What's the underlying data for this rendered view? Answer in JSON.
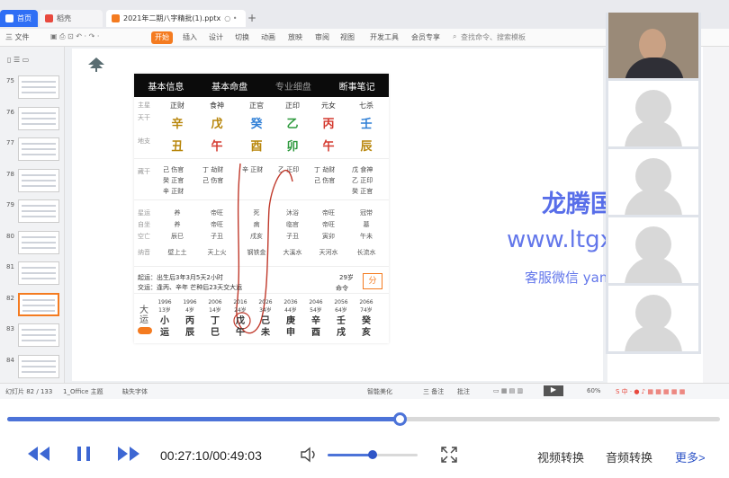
{
  "tabs": [
    {
      "label": "首页",
      "icon": "home-icon",
      "color": "#2f6ff5"
    },
    {
      "label": "稻壳",
      "icon": "docer-icon",
      "color": "#e8493e"
    },
    {
      "label": "2021年二期八字精批(1).pptx",
      "icon": "ppt-icon",
      "color": "#f47b20"
    }
  ],
  "menu": {
    "file": "三 文件",
    "items": [
      "开始",
      "插入",
      "设计",
      "切换",
      "动画",
      "放映",
      "审阅",
      "视图",
      "开发工具",
      "会员专享"
    ],
    "search": "查找命令、搜索模板"
  },
  "slides": {
    "numbers": [
      "75",
      "76",
      "77",
      "78",
      "79",
      "80",
      "81",
      "82",
      "83",
      "84"
    ],
    "selected": "82"
  },
  "panel": {
    "tabs": [
      "基本信息",
      "基本命盘",
      "专业细盘",
      "断事笔记"
    ],
    "active_tab": "专业细盘",
    "row_labels": [
      "主星",
      "天干",
      "地支",
      "藏干",
      "星运",
      "自坐",
      "空亡",
      "纳音"
    ],
    "ten_gods": [
      "正财",
      "食神",
      "正官",
      "正印",
      "元女",
      "七杀"
    ],
    "stems": [
      {
        "char": "辛",
        "color": "#b8860b"
      },
      {
        "char": "戊",
        "color": "#b8860b"
      },
      {
        "char": "癸",
        "color": "#2f7fd6"
      },
      {
        "char": "乙",
        "color": "#2e9a3e"
      },
      {
        "char": "丙",
        "color": "#d43a2f"
      },
      {
        "char": "壬",
        "color": "#2f7fd6"
      }
    ],
    "branches": [
      {
        "char": "丑",
        "color": "#b8860b"
      },
      {
        "char": "午",
        "color": "#d43a2f"
      },
      {
        "char": "酉",
        "color": "#b8860b"
      },
      {
        "char": "卯",
        "color": "#2e9a3e"
      },
      {
        "char": "午",
        "color": "#d43a2f"
      },
      {
        "char": "辰",
        "color": "#b8860b"
      }
    ],
    "hidden_stems": [
      [
        "己 伤官",
        "癸 正官",
        "辛 正财"
      ],
      [
        "丁 劫财",
        "己 伤官"
      ],
      [
        "辛 正财"
      ],
      [
        "乙 正印"
      ],
      [
        "丁 劫财",
        "己 伤官"
      ],
      [
        "戊 食神",
        "乙 正印",
        "癸 正官"
      ]
    ],
    "star_luck": [
      "养",
      "帝旺",
      "死",
      "沐浴",
      "帝旺",
      "冠带"
    ],
    "self_seat": [
      "养",
      "帝旺",
      "病",
      "临官",
      "帝旺",
      "墓"
    ],
    "kong_wang": [
      "辰巳",
      "子丑",
      "戌亥",
      "子丑",
      "寅卯",
      "午未"
    ],
    "na_yin": [
      "壁上土",
      "天上火",
      "钢铁金",
      "大溪水",
      "天河水",
      "长流水"
    ],
    "info1": "起运：出生后3年3月5天2小时",
    "info2": "交运：逢丙、辛年 芒种后23天交大运",
    "age": "29岁",
    "dayun_label_now": "命令",
    "share_label": "分",
    "dayun_label": "大运",
    "dayun": [
      {
        "year": "1996",
        "age": "13岁",
        "stem": "小",
        "branch": "运"
      },
      {
        "year": "1996",
        "age": "4岁",
        "stem": "丙",
        "branch": "辰"
      },
      {
        "year": "2006",
        "age": "14岁",
        "stem": "丁",
        "branch": "巳"
      },
      {
        "year": "2016",
        "age": "24岁",
        "stem": "戊",
        "branch": "午"
      },
      {
        "year": "2026",
        "age": "34岁",
        "stem": "己",
        "branch": "未"
      },
      {
        "year": "2036",
        "age": "44岁",
        "stem": "庚",
        "branch": "申"
      },
      {
        "year": "2046",
        "age": "54岁",
        "stem": "辛",
        "branch": "酉"
      },
      {
        "year": "2056",
        "age": "64岁",
        "stem": "壬",
        "branch": "戌"
      },
      {
        "year": "2066",
        "age": "74岁",
        "stem": "癸",
        "branch": "亥"
      }
    ]
  },
  "watermark": {
    "line1": "龙腾国学网",
    "line2": "www.ltgx99.com",
    "line3": "客服微信 yanliaofan225"
  },
  "statusbar": {
    "slide_info": "幻灯片 82 / 133",
    "theme": "1_Office 主题",
    "font": "缺失字体",
    "smart": "智能美化",
    "notes": "三 备注",
    "comment": "批注",
    "zoom": "60%"
  },
  "player": {
    "time": "00:27:10/00:49:03",
    "progress": 0.55,
    "volume": 0.5,
    "buttons": [
      "视频转换",
      "音频转换",
      "更多>"
    ]
  },
  "colors": {
    "accent": "#4c73d8",
    "office_orange": "#f47b20",
    "watermark": "#3b55e6"
  }
}
